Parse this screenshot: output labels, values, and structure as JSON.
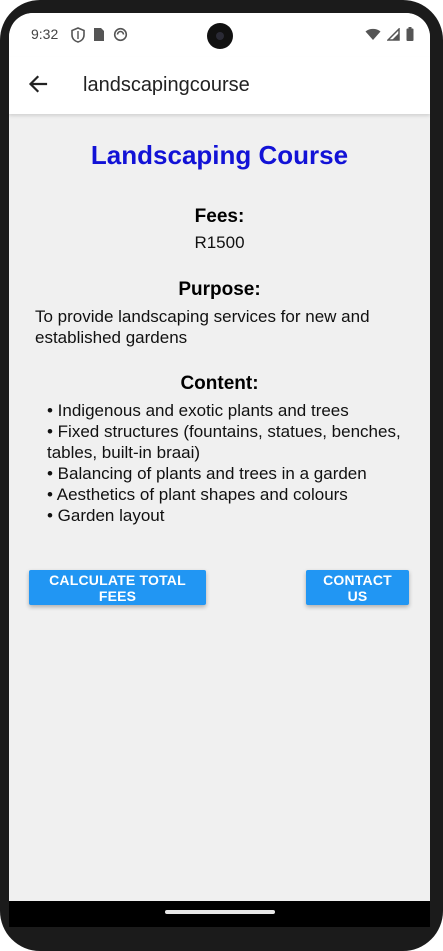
{
  "status_bar": {
    "time": "9:32",
    "left_icons": [
      "vpn-shield-icon",
      "sim-card-icon",
      "data-saver-icon"
    ],
    "right_icons": [
      "wifi-icon",
      "signal-icon",
      "battery-icon"
    ]
  },
  "app_bar": {
    "title": "landscapingcourse",
    "back_icon": "arrow-left-icon"
  },
  "course": {
    "title": "Landscaping Course",
    "title_color": "#1212d6",
    "fees_heading": "Fees:",
    "fees_value": "R1500",
    "purpose_heading": "Purpose:",
    "purpose_text": "To provide landscaping services for new and established gardens",
    "content_heading": "Content:",
    "content_items": [
      "• Indigenous and exotic plants and trees",
      "• Fixed structures (fountains, statues, benches, tables, built-in braai)",
      "• Balancing of plants and trees in a garden",
      "• Aesthetics of plant shapes and colours",
      "• Garden layout"
    ]
  },
  "buttons": {
    "calculate_label": "CALCULATE TOTAL FEES",
    "contact_label": "CONTACT US",
    "color": "#2196f3"
  }
}
